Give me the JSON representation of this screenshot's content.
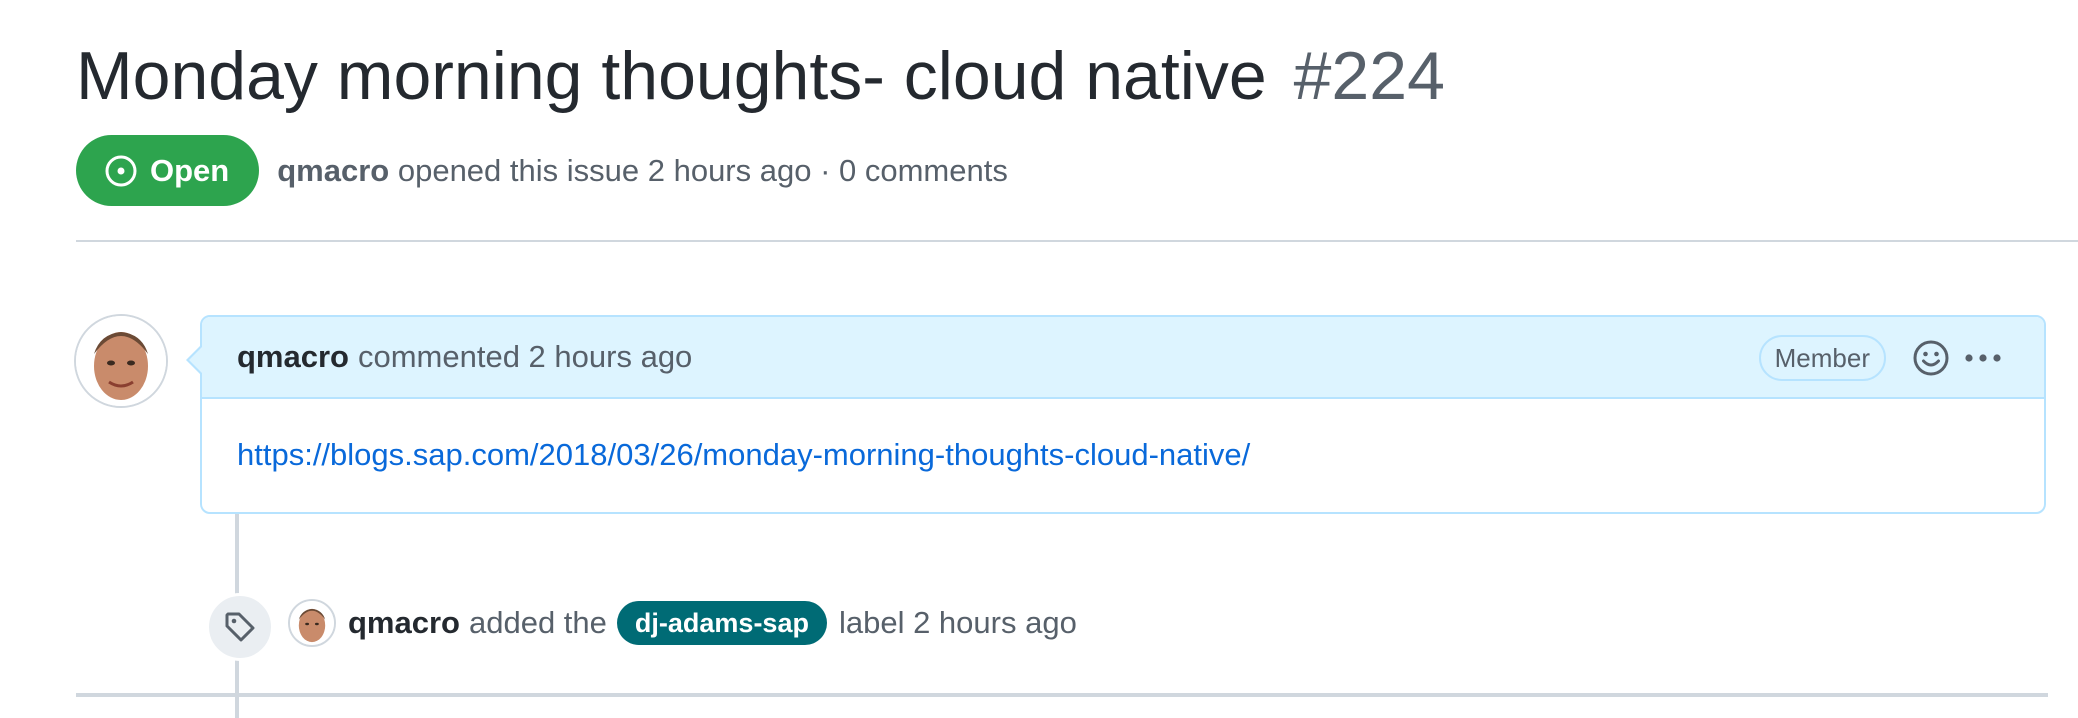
{
  "issue": {
    "title": "Monday morning thoughts- cloud native",
    "number": "#224",
    "state": "Open",
    "author": "qmacro",
    "opened_text": "opened this issue 2 hours ago · 0 comments"
  },
  "comment": {
    "author": "qmacro",
    "action": "commented 2 hours ago",
    "role_badge": "Member",
    "body_link": "https://blogs.sap.com/2018/03/26/monday-morning-thoughts-cloud-native/"
  },
  "event": {
    "author": "qmacro",
    "action": "added the",
    "label": "dj-adams-sap",
    "label_color": "#006b75",
    "suffix": "label 2 hours ago"
  },
  "colors": {
    "open_badge": "#2da44e",
    "link": "#0969da",
    "comment_header_bg": "#ddf4ff"
  }
}
